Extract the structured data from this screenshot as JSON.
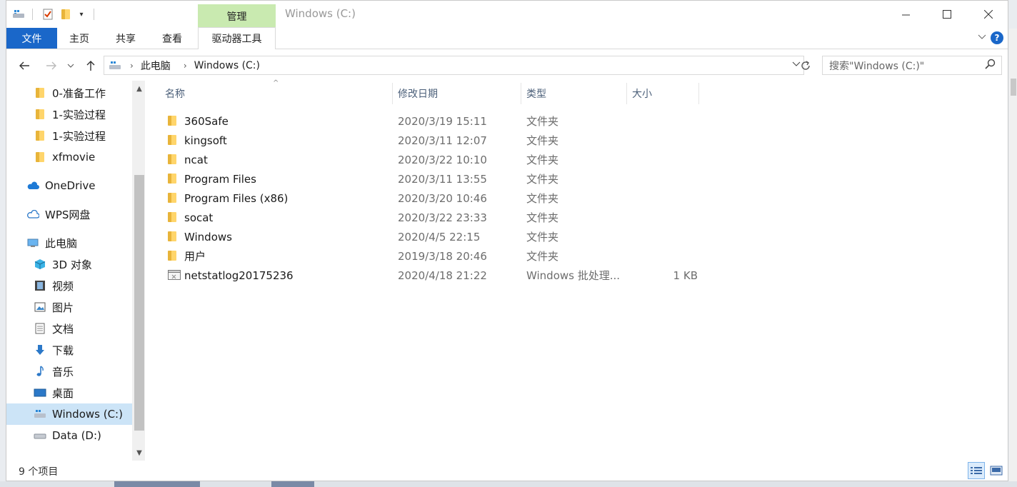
{
  "window": {
    "title": "Windows (C:)"
  },
  "ribbon": {
    "context_group": "管理",
    "tabs": [
      "文件",
      "主页",
      "共享",
      "查看",
      "驱动器工具"
    ]
  },
  "address": {
    "crumbs": [
      "此电脑",
      "Windows (C:)"
    ],
    "search_placeholder": "搜索\"Windows (C:)\""
  },
  "navpane": {
    "items": [
      {
        "label": "0-准备工作",
        "icon": "folder-icon"
      },
      {
        "label": "1-实验过程",
        "icon": "folder-icon"
      },
      {
        "label": "1-实验过程",
        "icon": "folder-icon"
      },
      {
        "label": "xfmovie",
        "icon": "folder-icon"
      },
      {
        "label": "OneDrive",
        "icon": "cloud-icon"
      },
      {
        "label": "WPS网盘",
        "icon": "cloud-outline-icon"
      },
      {
        "label": "此电脑",
        "icon": "computer-icon"
      },
      {
        "label": "3D 对象",
        "icon": "cube-icon"
      },
      {
        "label": "视频",
        "icon": "film-icon"
      },
      {
        "label": "图片",
        "icon": "picture-icon"
      },
      {
        "label": "文档",
        "icon": "document-icon"
      },
      {
        "label": "下载",
        "icon": "download-icon"
      },
      {
        "label": "音乐",
        "icon": "music-icon"
      },
      {
        "label": "桌面",
        "icon": "desktop-icon"
      },
      {
        "label": "Windows (C:)",
        "icon": "drive-c-icon",
        "selected": true
      },
      {
        "label": "Data (D:)",
        "icon": "drive-icon"
      }
    ]
  },
  "columns": {
    "name": "名称",
    "date": "修改日期",
    "type": "类型",
    "size": "大小"
  },
  "files": [
    {
      "name": "360Safe",
      "date": "2020/3/19 15:11",
      "type": "文件夹",
      "size": "",
      "icon": "folder-icon"
    },
    {
      "name": "kingsoft",
      "date": "2020/3/11 12:07",
      "type": "文件夹",
      "size": "",
      "icon": "folder-icon"
    },
    {
      "name": "ncat",
      "date": "2020/3/22 10:10",
      "type": "文件夹",
      "size": "",
      "icon": "folder-icon"
    },
    {
      "name": "Program Files",
      "date": "2020/3/11 13:55",
      "type": "文件夹",
      "size": "",
      "icon": "folder-icon"
    },
    {
      "name": "Program Files (x86)",
      "date": "2020/3/20 10:46",
      "type": "文件夹",
      "size": "",
      "icon": "folder-icon"
    },
    {
      "name": "socat",
      "date": "2020/3/22 23:33",
      "type": "文件夹",
      "size": "",
      "icon": "folder-icon"
    },
    {
      "name": "Windows",
      "date": "2020/4/5 22:15",
      "type": "文件夹",
      "size": "",
      "icon": "folder-icon"
    },
    {
      "name": "用户",
      "date": "2019/3/18 20:46",
      "type": "文件夹",
      "size": "",
      "icon": "folder-icon"
    },
    {
      "name": "netstatlog20175236",
      "date": "2020/4/18 21:22",
      "type": "Windows 批处理...",
      "size": "1 KB",
      "icon": "batch-file-icon"
    }
  ],
  "status": {
    "count": "9 个项目"
  },
  "colors": {
    "accent": "#1a67c9",
    "manage_tab": "#c9eab0",
    "selection": "#cce4f7"
  }
}
